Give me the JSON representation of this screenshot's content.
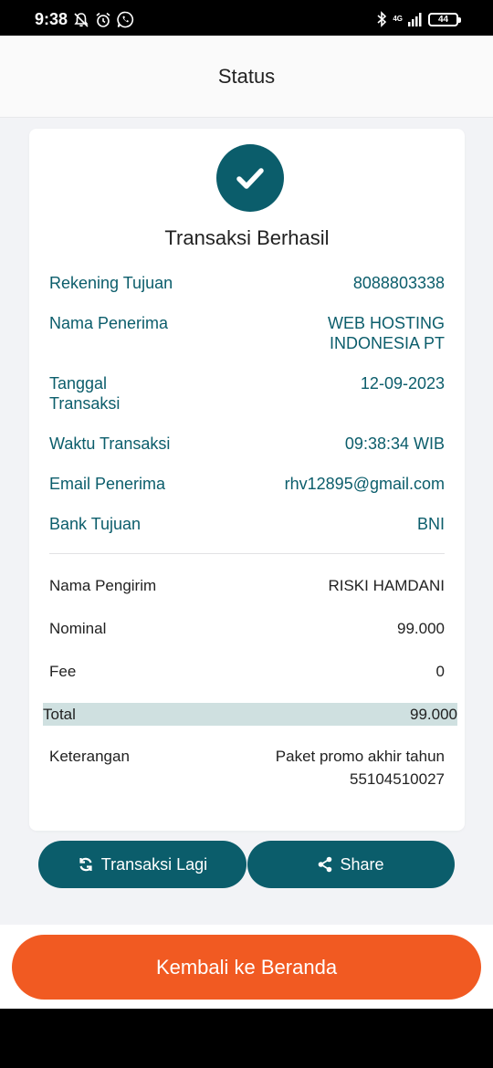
{
  "status_bar": {
    "time": "9:38",
    "network": "4G",
    "battery": "44"
  },
  "header": {
    "title": "Status"
  },
  "result": {
    "title": "Transaksi Berhasil",
    "details": [
      {
        "label": "Rekening Tujuan",
        "value": "8088803338"
      },
      {
        "label": "Nama Penerima",
        "value_line1": "WEB HOSTING",
        "value_line2": "INDONESIA PT"
      },
      {
        "label_line1": "Tanggal",
        "label_line2": "Transaksi",
        "value": "12-09-2023"
      },
      {
        "label": "Waktu Transaksi",
        "value": "09:38:34 WIB"
      },
      {
        "label": "Email Penerima",
        "value": "rhv12895@gmail.com"
      },
      {
        "label": "Bank Tujuan",
        "value": "BNI"
      }
    ],
    "summary": [
      {
        "label": "Nama Pengirim",
        "value": "RISKI HAMDANI"
      },
      {
        "label": "Nominal",
        "value": "99.000"
      },
      {
        "label": "Fee",
        "value": "0"
      }
    ],
    "total": {
      "label": "Total",
      "value": "99.000"
    },
    "note": {
      "label": "Keterangan",
      "value_line1": "Paket promo akhir tahun",
      "value_line2": "55104510027"
    }
  },
  "actions": {
    "retry_label": "Transaksi Lagi",
    "share_label": "Share",
    "home_label": "Kembali ke Beranda"
  },
  "colors": {
    "primary": "#0b5d6b",
    "accent": "#f15a22",
    "total_bg": "#cfe0e0"
  }
}
